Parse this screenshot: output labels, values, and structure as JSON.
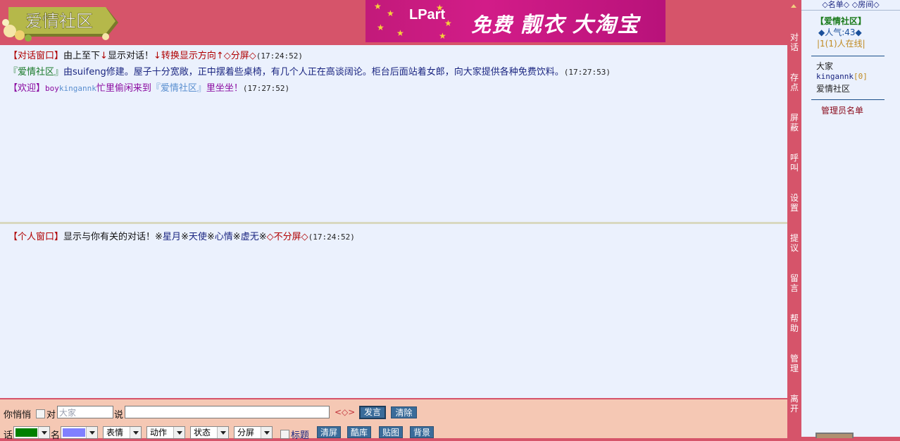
{
  "header": {
    "logo_text": "爱情社区",
    "banner": {
      "brand": "LPart",
      "slogan_a": "免费",
      "slogan_b": "靓衣",
      "slogan_c": "大淘宝"
    }
  },
  "chat": {
    "line1": {
      "a": "【对话窗口】",
      "b": "由上至下",
      "arrow1": "↓",
      "c": "显示对话！",
      "d": "↓转换显示方向↑",
      "e": "◇分屏◇",
      "time": "(17:24:52)"
    },
    "line2": {
      "a": "『爱情社区』",
      "b": "由suifeng修建。屋子十分宽敞，正中摆着些桌椅，有几个人正在高谈阔论。柜台后面站着女郎，向大家提供各种免费饮料。",
      "time": "(17:27:53)"
    },
    "line3": {
      "a": "【欢迎】",
      "b": "boy",
      "c": "kingannk",
      "d": "忙里偷闲来到",
      "e": "『爱情社区』",
      "f": "里坐坐！",
      "time": "(17:27:52)"
    }
  },
  "personal": {
    "line1": {
      "a": "【个人窗口】",
      "b": "显示与你有关的对话！※",
      "c": "星月",
      "d": "※",
      "e": "天使",
      "f": "※",
      "g": "心情",
      "h": "※",
      "i": "虚无",
      "j": "※",
      "k": "◇不分屏◇",
      "time": "(17:24:52)"
    }
  },
  "input_bar": {
    "whisper_label": "你悄悄",
    "to_label": "对",
    "target_value": "大家",
    "say_label": "说",
    "message_value": "",
    "face_symbol": "<◇>",
    "send_label": "发言",
    "clear_label": "清除",
    "color_label": "话",
    "name_label": "名",
    "text_color": "#008000",
    "name_color": "#8080ff",
    "dropdowns": [
      "表情",
      "动作",
      "状态",
      "分屏"
    ],
    "title_label": "标题",
    "buttons": [
      "清屏",
      "酷库",
      "贴图",
      "背景"
    ]
  },
  "nav": [
    "对话",
    "存点",
    "屏蔽",
    "呼叫",
    "设置",
    "提议",
    "留言",
    "帮助",
    "管理",
    "离开"
  ],
  "right_panel": {
    "tabs": "◇名单◇ ◇房间◇",
    "room_name": "【爱情社区】",
    "popularity": "◆人气:43◆",
    "online": "|1(1)人在线|",
    "users": [
      "大家",
      "kingannk",
      "[0]",
      "爱情社区"
    ],
    "admin_list": "管理员名单"
  }
}
